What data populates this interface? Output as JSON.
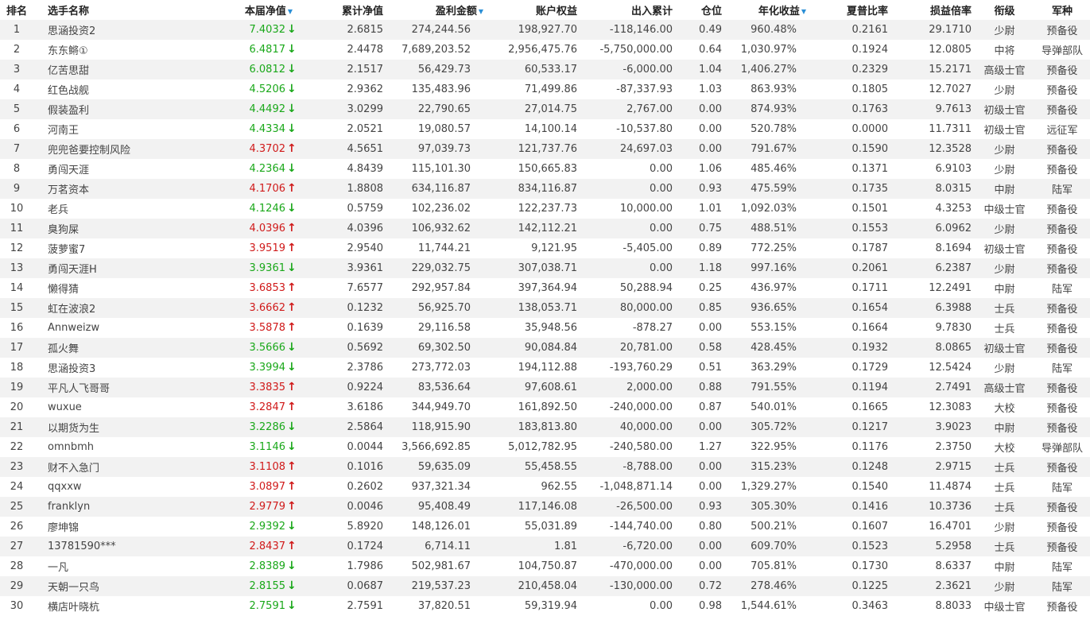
{
  "columns": {
    "rank": "排名",
    "name": "选手名称",
    "nav": "本届净值",
    "cum_nav": "累计净值",
    "profit": "盈利金额",
    "equity": "账户权益",
    "flow": "出入累计",
    "position": "仓位",
    "annual": "年化收益",
    "sharpe": "夏普比率",
    "pl_ratio": "损益倍率",
    "rank_title": "衔级",
    "branch": "军种"
  },
  "sorted_columns": [
    "nav",
    "profit",
    "annual"
  ],
  "colors": {
    "down": "#1aa81a",
    "up": "#d01a1a",
    "sort_indicator": "#2a8fd6",
    "row_stripe": "#f2f2f2"
  },
  "rows": [
    {
      "rank": "1",
      "name": "思涵投资2",
      "nav": "7.4032",
      "trend": "down",
      "cum_nav": "2.6815",
      "profit": "274,244.56",
      "equity": "198,927.70",
      "flow": "-118,146.00",
      "position": "0.49",
      "annual": "960.48%",
      "sharpe": "0.2161",
      "pl_ratio": "29.1710",
      "rank_title": "少尉",
      "branch": "预备役"
    },
    {
      "rank": "2",
      "name": "东东鳉①",
      "nav": "6.4817",
      "trend": "down",
      "cum_nav": "2.4478",
      "profit": "7,689,203.52",
      "equity": "2,956,475.76",
      "flow": "-5,750,000.00",
      "position": "0.64",
      "annual": "1,030.97%",
      "sharpe": "0.1924",
      "pl_ratio": "12.0805",
      "rank_title": "中将",
      "branch": "导弹部队"
    },
    {
      "rank": "3",
      "name": "亿苦思甜",
      "nav": "6.0812",
      "trend": "down",
      "cum_nav": "2.1517",
      "profit": "56,429.73",
      "equity": "60,533.17",
      "flow": "-6,000.00",
      "position": "1.04",
      "annual": "1,406.27%",
      "sharpe": "0.2329",
      "pl_ratio": "15.2171",
      "rank_title": "高级士官",
      "branch": "预备役"
    },
    {
      "rank": "4",
      "name": "红色战舰",
      "nav": "4.5206",
      "trend": "down",
      "cum_nav": "2.9362",
      "profit": "135,483.96",
      "equity": "71,499.86",
      "flow": "-87,337.93",
      "position": "1.03",
      "annual": "863.93%",
      "sharpe": "0.1805",
      "pl_ratio": "12.7027",
      "rank_title": "少尉",
      "branch": "预备役"
    },
    {
      "rank": "5",
      "name": "假装盈利",
      "nav": "4.4492",
      "trend": "down",
      "cum_nav": "3.0299",
      "profit": "22,790.65",
      "equity": "27,014.75",
      "flow": "2,767.00",
      "position": "0.00",
      "annual": "874.93%",
      "sharpe": "0.1763",
      "pl_ratio": "9.7613",
      "rank_title": "初级士官",
      "branch": "预备役"
    },
    {
      "rank": "6",
      "name": "河南王",
      "nav": "4.4334",
      "trend": "down",
      "cum_nav": "2.0521",
      "profit": "19,080.57",
      "equity": "14,100.14",
      "flow": "-10,537.80",
      "position": "0.00",
      "annual": "520.78%",
      "sharpe": "0.0000",
      "pl_ratio": "11.7311",
      "rank_title": "初级士官",
      "branch": "远征军"
    },
    {
      "rank": "7",
      "name": "兜兜爸要控制风险",
      "nav": "4.3702",
      "trend": "up",
      "cum_nav": "4.5651",
      "profit": "97,039.73",
      "equity": "121,737.76",
      "flow": "24,697.03",
      "position": "0.00",
      "annual": "791.67%",
      "sharpe": "0.1590",
      "pl_ratio": "12.3528",
      "rank_title": "少尉",
      "branch": "预备役"
    },
    {
      "rank": "8",
      "name": "勇闯天涯",
      "nav": "4.2364",
      "trend": "down",
      "cum_nav": "4.8439",
      "profit": "115,101.30",
      "equity": "150,665.83",
      "flow": "0.00",
      "position": "1.06",
      "annual": "485.46%",
      "sharpe": "0.1371",
      "pl_ratio": "6.9103",
      "rank_title": "少尉",
      "branch": "预备役"
    },
    {
      "rank": "9",
      "name": "万茗资本",
      "nav": "4.1706",
      "trend": "up",
      "cum_nav": "1.8808",
      "profit": "634,116.87",
      "equity": "834,116.87",
      "flow": "0.00",
      "position": "0.93",
      "annual": "475.59%",
      "sharpe": "0.1735",
      "pl_ratio": "8.0315",
      "rank_title": "中尉",
      "branch": "陆军"
    },
    {
      "rank": "10",
      "name": "老兵",
      "nav": "4.1246",
      "trend": "down",
      "cum_nav": "0.5759",
      "profit": "102,236.02",
      "equity": "122,237.73",
      "flow": "10,000.00",
      "position": "1.01",
      "annual": "1,092.03%",
      "sharpe": "0.1501",
      "pl_ratio": "4.3253",
      "rank_title": "中级士官",
      "branch": "预备役"
    },
    {
      "rank": "11",
      "name": "臭狗屎",
      "nav": "4.0396",
      "trend": "up",
      "cum_nav": "4.0396",
      "profit": "106,932.62",
      "equity": "142,112.21",
      "flow": "0.00",
      "position": "0.75",
      "annual": "488.51%",
      "sharpe": "0.1553",
      "pl_ratio": "6.0962",
      "rank_title": "少尉",
      "branch": "预备役"
    },
    {
      "rank": "12",
      "name": "菠萝蜜7",
      "nav": "3.9519",
      "trend": "up",
      "cum_nav": "2.9540",
      "profit": "11,744.21",
      "equity": "9,121.95",
      "flow": "-5,405.00",
      "position": "0.89",
      "annual": "772.25%",
      "sharpe": "0.1787",
      "pl_ratio": "8.1694",
      "rank_title": "初级士官",
      "branch": "预备役"
    },
    {
      "rank": "13",
      "name": "勇闯天涯H",
      "nav": "3.9361",
      "trend": "down",
      "cum_nav": "3.9361",
      "profit": "229,032.75",
      "equity": "307,038.71",
      "flow": "0.00",
      "position": "1.18",
      "annual": "997.16%",
      "sharpe": "0.2061",
      "pl_ratio": "6.2387",
      "rank_title": "少尉",
      "branch": "预备役"
    },
    {
      "rank": "14",
      "name": "懒得猜",
      "nav": "3.6853",
      "trend": "up",
      "cum_nav": "7.6577",
      "profit": "292,957.84",
      "equity": "397,364.94",
      "flow": "50,288.94",
      "position": "0.25",
      "annual": "436.97%",
      "sharpe": "0.1711",
      "pl_ratio": "12.2491",
      "rank_title": "中尉",
      "branch": "陆军"
    },
    {
      "rank": "15",
      "name": "虹在波浪2",
      "nav": "3.6662",
      "trend": "up",
      "cum_nav": "0.1232",
      "profit": "56,925.70",
      "equity": "138,053.71",
      "flow": "80,000.00",
      "position": "0.85",
      "annual": "936.65%",
      "sharpe": "0.1654",
      "pl_ratio": "6.3988",
      "rank_title": "士兵",
      "branch": "预备役"
    },
    {
      "rank": "16",
      "name": "Annweizw",
      "nav": "3.5878",
      "trend": "up",
      "cum_nav": "0.1639",
      "profit": "29,116.58",
      "equity": "35,948.56",
      "flow": "-878.27",
      "position": "0.00",
      "annual": "553.15%",
      "sharpe": "0.1664",
      "pl_ratio": "9.7830",
      "rank_title": "士兵",
      "branch": "预备役"
    },
    {
      "rank": "17",
      "name": "孤火舞",
      "nav": "3.5666",
      "trend": "down",
      "cum_nav": "0.5692",
      "profit": "69,302.50",
      "equity": "90,084.84",
      "flow": "20,781.00",
      "position": "0.58",
      "annual": "428.45%",
      "sharpe": "0.1932",
      "pl_ratio": "8.0865",
      "rank_title": "初级士官",
      "branch": "预备役"
    },
    {
      "rank": "18",
      "name": "思涵投资3",
      "nav": "3.3994",
      "trend": "down",
      "cum_nav": "2.3786",
      "profit": "273,772.03",
      "equity": "194,112.88",
      "flow": "-193,760.29",
      "position": "0.51",
      "annual": "363.29%",
      "sharpe": "0.1729",
      "pl_ratio": "12.5424",
      "rank_title": "少尉",
      "branch": "陆军"
    },
    {
      "rank": "19",
      "name": "平凡人飞哥哥",
      "nav": "3.3835",
      "trend": "up",
      "cum_nav": "0.9224",
      "profit": "83,536.64",
      "equity": "97,608.61",
      "flow": "2,000.00",
      "position": "0.88",
      "annual": "791.55%",
      "sharpe": "0.1194",
      "pl_ratio": "2.7491",
      "rank_title": "高级士官",
      "branch": "预备役"
    },
    {
      "rank": "20",
      "name": "wuxue",
      "nav": "3.2847",
      "trend": "up",
      "cum_nav": "3.6186",
      "profit": "344,949.70",
      "equity": "161,892.50",
      "flow": "-240,000.00",
      "position": "0.87",
      "annual": "540.01%",
      "sharpe": "0.1665",
      "pl_ratio": "12.3083",
      "rank_title": "大校",
      "branch": "预备役"
    },
    {
      "rank": "21",
      "name": "以期货为生",
      "nav": "3.2286",
      "trend": "down",
      "cum_nav": "2.5864",
      "profit": "118,915.90",
      "equity": "183,813.80",
      "flow": "40,000.00",
      "position": "0.00",
      "annual": "305.72%",
      "sharpe": "0.1217",
      "pl_ratio": "3.9023",
      "rank_title": "中尉",
      "branch": "预备役"
    },
    {
      "rank": "22",
      "name": "omnbmh",
      "nav": "3.1146",
      "trend": "down",
      "cum_nav": "0.0044",
      "profit": "3,566,692.85",
      "equity": "5,012,782.95",
      "flow": "-240,580.00",
      "position": "1.27",
      "annual": "322.95%",
      "sharpe": "0.1176",
      "pl_ratio": "2.3750",
      "rank_title": "大校",
      "branch": "导弹部队"
    },
    {
      "rank": "23",
      "name": "财不入急门",
      "nav": "3.1108",
      "trend": "up",
      "cum_nav": "0.1016",
      "profit": "59,635.09",
      "equity": "55,458.55",
      "flow": "-8,788.00",
      "position": "0.00",
      "annual": "315.23%",
      "sharpe": "0.1248",
      "pl_ratio": "2.9715",
      "rank_title": "士兵",
      "branch": "预备役"
    },
    {
      "rank": "24",
      "name": "qqxxw",
      "nav": "3.0897",
      "trend": "up",
      "cum_nav": "0.2602",
      "profit": "937,321.34",
      "equity": "962.55",
      "flow": "-1,048,871.14",
      "position": "0.00",
      "annual": "1,329.27%",
      "sharpe": "0.1540",
      "pl_ratio": "11.4874",
      "rank_title": "士兵",
      "branch": "陆军"
    },
    {
      "rank": "25",
      "name": "franklyn",
      "nav": "2.9779",
      "trend": "up",
      "cum_nav": "0.0046",
      "profit": "95,408.49",
      "equity": "117,146.08",
      "flow": "-26,500.00",
      "position": "0.93",
      "annual": "305.30%",
      "sharpe": "0.1416",
      "pl_ratio": "10.3736",
      "rank_title": "士兵",
      "branch": "预备役"
    },
    {
      "rank": "26",
      "name": "廖坤锦",
      "nav": "2.9392",
      "trend": "down",
      "cum_nav": "5.8920",
      "profit": "148,126.01",
      "equity": "55,031.89",
      "flow": "-144,740.00",
      "position": "0.80",
      "annual": "500.21%",
      "sharpe": "0.1607",
      "pl_ratio": "16.4701",
      "rank_title": "少尉",
      "branch": "预备役"
    },
    {
      "rank": "27",
      "name": "13781590***",
      "nav": "2.8437",
      "trend": "up",
      "cum_nav": "0.1724",
      "profit": "6,714.11",
      "equity": "1.81",
      "flow": "-6,720.00",
      "position": "0.00",
      "annual": "609.70%",
      "sharpe": "0.1523",
      "pl_ratio": "5.2958",
      "rank_title": "士兵",
      "branch": "预备役"
    },
    {
      "rank": "28",
      "name": "一凡",
      "nav": "2.8389",
      "trend": "down",
      "cum_nav": "1.7986",
      "profit": "502,981.67",
      "equity": "104,750.87",
      "flow": "-470,000.00",
      "position": "0.00",
      "annual": "705.81%",
      "sharpe": "0.1730",
      "pl_ratio": "8.6337",
      "rank_title": "中尉",
      "branch": "陆军"
    },
    {
      "rank": "29",
      "name": "天朝一只鸟",
      "nav": "2.8155",
      "trend": "down",
      "cum_nav": "0.0687",
      "profit": "219,537.23",
      "equity": "210,458.04",
      "flow": "-130,000.00",
      "position": "0.72",
      "annual": "278.46%",
      "sharpe": "0.1225",
      "pl_ratio": "2.3621",
      "rank_title": "少尉",
      "branch": "陆军"
    },
    {
      "rank": "30",
      "name": "横店叶晓杭",
      "nav": "2.7591",
      "trend": "down",
      "cum_nav": "2.7591",
      "profit": "37,820.51",
      "equity": "59,319.94",
      "flow": "0.00",
      "position": "0.98",
      "annual": "1,544.61%",
      "sharpe": "0.3463",
      "pl_ratio": "8.8033",
      "rank_title": "中级士官",
      "branch": "预备役"
    }
  ]
}
